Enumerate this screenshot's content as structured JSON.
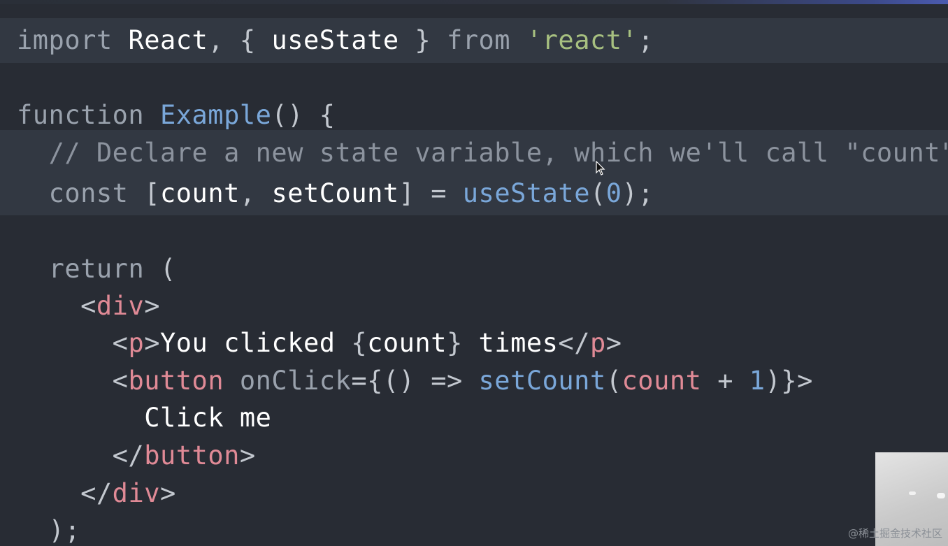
{
  "editor": {
    "lines": [
      {
        "indent": "",
        "tokens": [
          {
            "c": "kw",
            "t": "import "
          },
          {
            "c": "id",
            "t": "React"
          },
          {
            "c": "pun",
            "t": ", { "
          },
          {
            "c": "id",
            "t": "useState"
          },
          {
            "c": "pun",
            "t": " } "
          },
          {
            "c": "kw",
            "t": "from "
          },
          {
            "c": "str",
            "t": "'react'"
          },
          {
            "c": "pun",
            "t": ";"
          }
        ]
      },
      {
        "indent": "",
        "tokens": []
      },
      {
        "indent": "",
        "tokens": [
          {
            "c": "kw",
            "t": "function "
          },
          {
            "c": "fn",
            "t": "Example"
          },
          {
            "c": "pun",
            "t": "() {"
          }
        ]
      },
      {
        "indent": "  ",
        "tokens": [
          {
            "c": "cm",
            "t": "// Declare a new state variable, which we'll call \"count\""
          }
        ]
      },
      {
        "indent": "  ",
        "tokens": [
          {
            "c": "kw",
            "t": "const "
          },
          {
            "c": "pun",
            "t": "["
          },
          {
            "c": "id",
            "t": "count"
          },
          {
            "c": "pun",
            "t": ", "
          },
          {
            "c": "id",
            "t": "setCount"
          },
          {
            "c": "pun",
            "t": "] = "
          },
          {
            "c": "fn",
            "t": "useState"
          },
          {
            "c": "pun",
            "t": "("
          },
          {
            "c": "num",
            "t": "0"
          },
          {
            "c": "pun",
            "t": ");"
          }
        ]
      },
      {
        "indent": "",
        "tokens": []
      },
      {
        "indent": "  ",
        "tokens": [
          {
            "c": "kw",
            "t": "return "
          },
          {
            "c": "pun",
            "t": "("
          }
        ]
      },
      {
        "indent": "    ",
        "tokens": [
          {
            "c": "pun",
            "t": "<"
          },
          {
            "c": "tag",
            "t": "div"
          },
          {
            "c": "pun",
            "t": ">"
          }
        ]
      },
      {
        "indent": "      ",
        "tokens": [
          {
            "c": "pun",
            "t": "<"
          },
          {
            "c": "tag",
            "t": "p"
          },
          {
            "c": "pun",
            "t": ">"
          },
          {
            "c": "txt",
            "t": "You clicked "
          },
          {
            "c": "pun",
            "t": "{"
          },
          {
            "c": "txt",
            "t": "count"
          },
          {
            "c": "pun",
            "t": "}"
          },
          {
            "c": "txt",
            "t": " times"
          },
          {
            "c": "pun",
            "t": "</"
          },
          {
            "c": "tag",
            "t": "p"
          },
          {
            "c": "pun",
            "t": ">"
          }
        ]
      },
      {
        "indent": "      ",
        "tokens": [
          {
            "c": "pun",
            "t": "<"
          },
          {
            "c": "tag",
            "t": "button "
          },
          {
            "c": "kw",
            "t": "onClick"
          },
          {
            "c": "pun",
            "t": "={() => "
          },
          {
            "c": "fn",
            "t": "setCount"
          },
          {
            "c": "pun",
            "t": "("
          },
          {
            "c": "tag",
            "t": "count"
          },
          {
            "c": "pun",
            "t": " + "
          },
          {
            "c": "num",
            "t": "1"
          },
          {
            "c": "pun",
            "t": ")}>"
          }
        ]
      },
      {
        "indent": "        ",
        "tokens": [
          {
            "c": "txt",
            "t": "Click me"
          }
        ]
      },
      {
        "indent": "      ",
        "tokens": [
          {
            "c": "pun",
            "t": "</"
          },
          {
            "c": "tag",
            "t": "button"
          },
          {
            "c": "pun",
            "t": ">"
          }
        ]
      },
      {
        "indent": "    ",
        "tokens": [
          {
            "c": "pun",
            "t": "</"
          },
          {
            "c": "tag",
            "t": "div"
          },
          {
            "c": "pun",
            "t": ">"
          }
        ]
      },
      {
        "indent": "  ",
        "tokens": [
          {
            "c": "pun",
            "t": ");"
          }
        ]
      }
    ],
    "highlighted_lines": [
      0,
      3,
      4
    ]
  },
  "colors": {
    "background": "#282c34",
    "highlight_band": "#323842",
    "keyword": "#9aa2ad",
    "string": "#a7c080",
    "function": "#7aa7d9",
    "tag": "#e08a96",
    "comment": "#8c939e"
  },
  "overlay": {
    "watermark": "@稀土掘金技术社区",
    "webcam_label": "webcam-thumbnail"
  }
}
